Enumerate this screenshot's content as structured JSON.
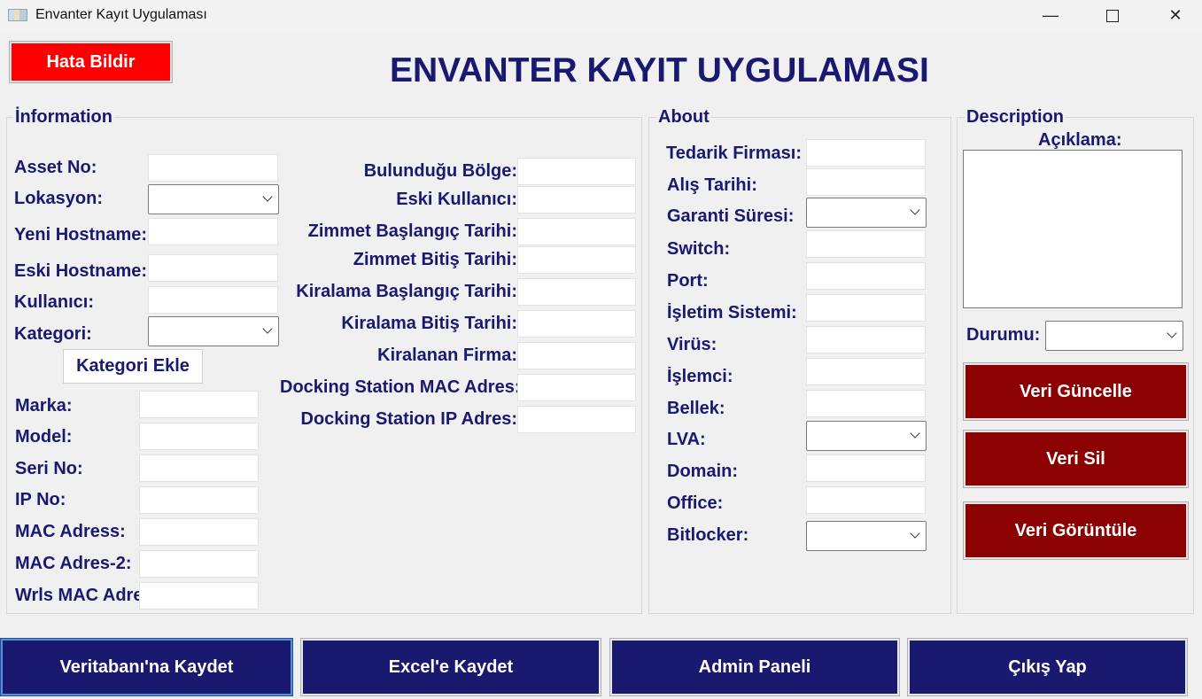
{
  "window": {
    "title": "Envanter Kayıt Uygulaması",
    "minimize": "—",
    "close": "✕"
  },
  "header": {
    "report_button": "Hata Bildir",
    "title": "ENVANTER KAYIT UYGULAMASI"
  },
  "information": {
    "group_title": "İnformation",
    "left_fields": {
      "asset_no": "Asset No:",
      "lokasyon": "Lokasyon:",
      "yeni_hostname": "Yeni Hostname:",
      "eski_hostname": "Eski Hostname:",
      "kullanici": "Kullanıcı:",
      "kategori": "Kategori:"
    },
    "kategori_ekle": "Kategori Ekle",
    "lower_fields": {
      "marka": "Marka:",
      "model": "Model:",
      "seri_no": "Seri No:",
      "ip_no": "IP No:",
      "mac_adress": "MAC Adress:",
      "mac_adres_2": "MAC Adres-2:",
      "wrls_mac": "Wrls MAC Adres:"
    },
    "right_fields": {
      "bulundugu_bolge": "Bulunduğu Bölge:",
      "eski_kullanici": "Eski Kullanıcı:",
      "zimmet_baslangic": "Zimmet Başlangıç Tarihi:",
      "zimmet_bitis": "Zimmet Bitiş Tarihi:",
      "kiralama_baslangic": "Kiralama Başlangıç Tarihi:",
      "kiralama_bitis": "Kiralama Bitiş Tarihi:",
      "kiralanan_firma": "Kiralanan Firma:",
      "docking_mac": "Docking Station MAC Adres:",
      "docking_ip": "Docking Station IP Adres:"
    }
  },
  "about": {
    "group_title": "About",
    "fields": {
      "tedarik_firmasi": "Tedarik Firması:",
      "alis_tarihi": "Alış Tarihi:",
      "garanti_suresi": "Garanti Süresi:",
      "switch": "Switch:",
      "port": "Port:",
      "isletim_sistemi": "İşletim Sistemi:",
      "virus": "Virüs:",
      "islemci": "İşlemci:",
      "bellek": "Bellek:",
      "lva": "LVA:",
      "domain": "Domain:",
      "office": "Office:",
      "bitlocker": "Bitlocker:"
    }
  },
  "description": {
    "group_title": "Description",
    "aciklama": "Açıklama:",
    "durumu": "Durumu:",
    "buttons": {
      "guncelle": "Veri Güncelle",
      "sil": "Veri Sil",
      "goruntule": "Veri Görüntüle"
    }
  },
  "footer": {
    "veritabani": "Veritabanı'na Kaydet",
    "excel": "Excel'e Kaydet",
    "admin": "Admin Paneli",
    "cikis": "Çıkış Yap"
  },
  "colors": {
    "navy": "#191970",
    "dark_red": "#8b0000",
    "red": "#ff0000",
    "background": "#f0f0f0"
  }
}
